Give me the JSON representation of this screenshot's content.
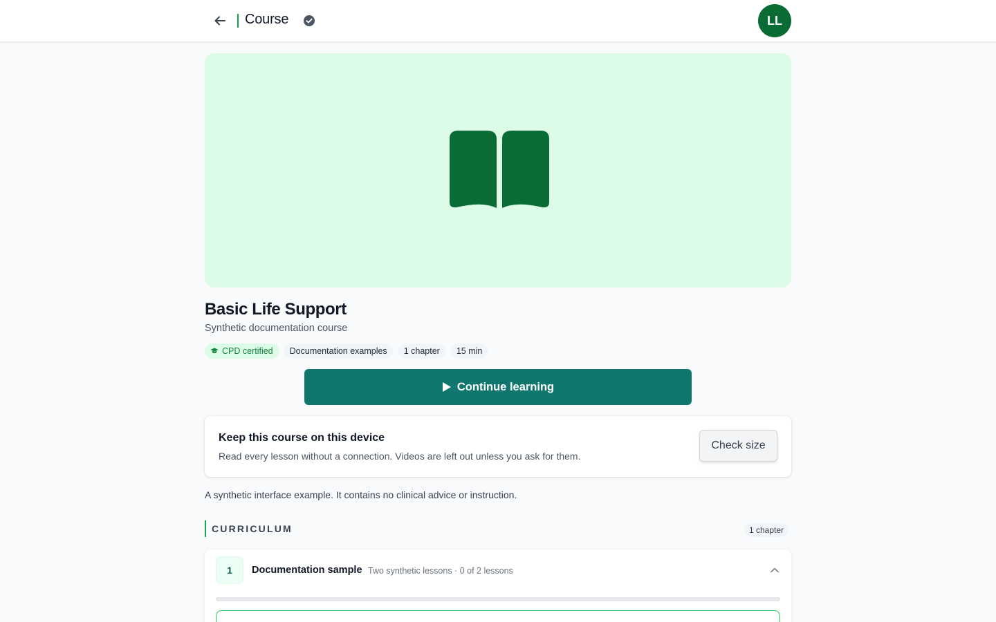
{
  "header": {
    "title": "Course",
    "avatar_initials": "LL"
  },
  "hero": {
    "icon": "book-open-icon",
    "background": "#dcfce7",
    "icon_color": "#0b6b34"
  },
  "course": {
    "title": "Basic Life Support",
    "subtitle": "Synthetic documentation course",
    "tags": {
      "cpd": "CPD certified",
      "category": "Documentation examples",
      "chapters": "1 chapter",
      "duration": "15 min"
    },
    "continue_label": "Continue learning"
  },
  "offline": {
    "title": "Keep this course on this device",
    "description": "Read every lesson without a connection. Videos are left out unless you ask for them.",
    "button_label": "Check size"
  },
  "disclaimer": "A synthetic interface example. It contains no clinical advice or instruction.",
  "curriculum": {
    "label": "CURRICULUM",
    "count": "1 chapter",
    "chapters": [
      {
        "number": "1",
        "title": "Documentation sample",
        "meta": "Two synthetic lessons · 0 of 2 lessons",
        "progress": 0
      }
    ]
  },
  "colors": {
    "accent": "#16a34a",
    "primary_button": "#11766d",
    "avatar": "#0b6b34"
  }
}
